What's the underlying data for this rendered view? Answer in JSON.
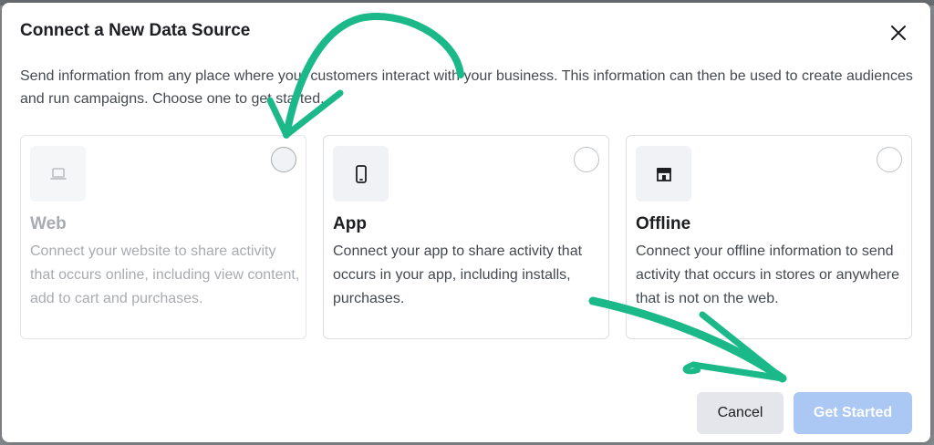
{
  "dialog": {
    "title": "Connect a New Data Source",
    "description": "Send information from any place where your customers interact with your business. This information can then be used to create audiences and run campaigns. Choose one to get started."
  },
  "options": [
    {
      "title": "Web",
      "description": "Connect your website to share activity that occurs online, including view content, add to cart and purchases.",
      "icon": "laptop-icon",
      "state": "disabled"
    },
    {
      "title": "App",
      "description": "Connect your app to share activity that occurs in your app, including installs, purchases.",
      "icon": "mobile-phone-icon",
      "state": "enabled"
    },
    {
      "title": "Offline",
      "description": "Connect your offline information to send activity that occurs in stores or anywhere that is not on the web.",
      "icon": "storefront-icon",
      "state": "enabled"
    }
  ],
  "buttons": {
    "cancel": "Cancel",
    "get_started": "Get Started"
  },
  "colors": {
    "primary_disabled": "#aac8f3",
    "annotation": "#1bb98a",
    "text": "#1c1e21",
    "secondary_text": "#444950"
  }
}
